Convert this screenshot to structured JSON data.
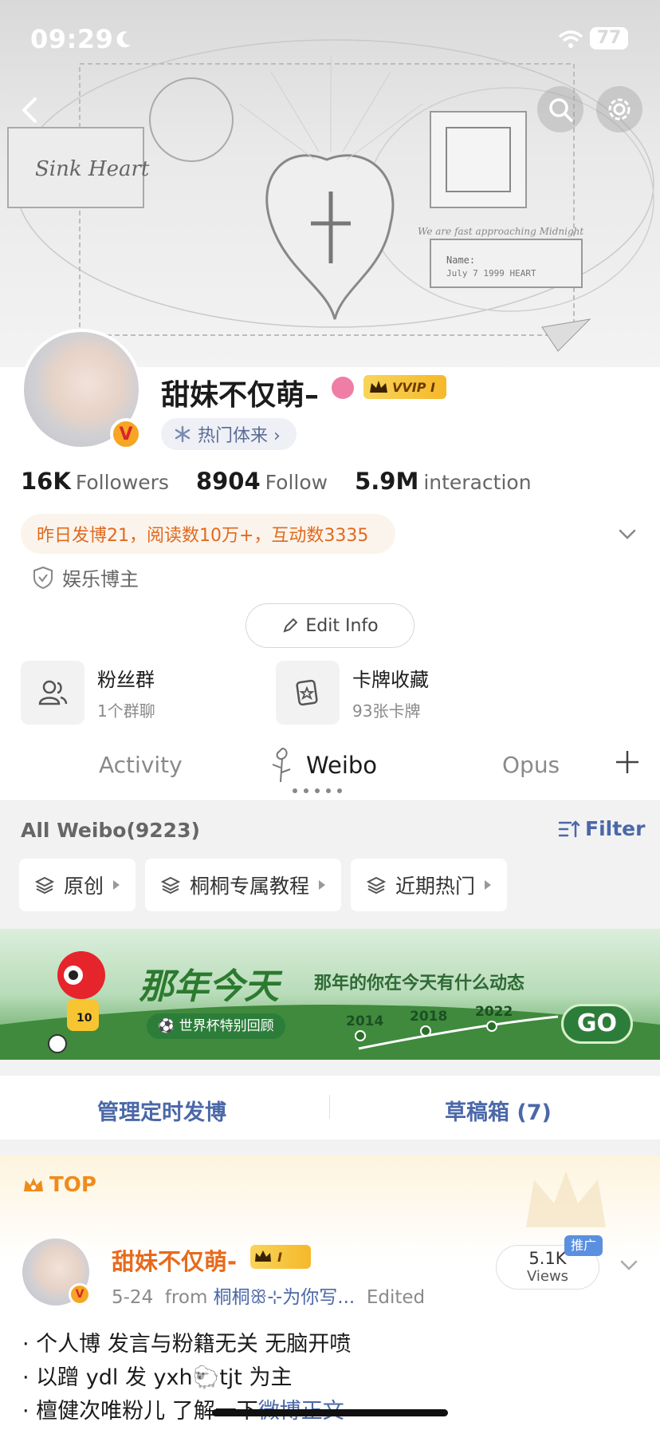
{
  "status_bar": {
    "time": "09:29",
    "battery": "77"
  },
  "profile": {
    "username": "甜妹不仅萌–",
    "vip_badge": "VVIP I",
    "hot_pill": "热门体来 ›",
    "stats": [
      {
        "value": "16K",
        "label": "Followers"
      },
      {
        "value": "8904",
        "label": "Follow"
      },
      {
        "value": "5.9M",
        "label": "interaction"
      }
    ],
    "summary": "昨日发博21，阅读数10万+，互动数3335",
    "certification": "娱乐博主",
    "edit_button": "Edit Info",
    "tiles": [
      {
        "title": "粉丝群",
        "subtitle": "1个群聊",
        "icon": "group-icon"
      },
      {
        "title": "卡牌收藏",
        "subtitle": "93张卡牌",
        "icon": "card-icon"
      }
    ]
  },
  "tabs": [
    {
      "label": "Activity",
      "active": false
    },
    {
      "label": "Weibo",
      "active": true
    },
    {
      "label": "Opus",
      "active": false
    }
  ],
  "feed": {
    "all_weibo": "All Weibo(9223)",
    "filter": "Filter",
    "categories": [
      "原创",
      "桐桐专属教程",
      "近期热门"
    ]
  },
  "banner": {
    "title": "那年今天",
    "subtitle": "那年的你在今天有什么动态",
    "chip": "⚽ 世界杯特别回顾",
    "years": [
      "2014",
      "2018",
      "2022"
    ],
    "go": "GO",
    "player_number": "10"
  },
  "schedule": {
    "manage": "管理定时发博",
    "drafts": "草稿箱 (7)"
  },
  "post": {
    "top_label": "TOP",
    "author": "甜妹不仅萌-",
    "author_vip": "I",
    "date": "5-24",
    "from_label": "from",
    "source": "桐桐ꕥ⊹为你写...",
    "edited": "Edited",
    "views_value": "5.1K",
    "views_label": "Views",
    "promo": "推广",
    "lines": [
      "· 个人博 发言与粉籍无关 无脑开喷",
      "· 以蹭 ydl 发 yxh🐑tjt 为主",
      "· 檀健次唯粉儿 了解一下"
    ],
    "link": "微博正文"
  },
  "colors": {
    "accent_orange": "#e86a1c",
    "link_blue": "#4b68a8",
    "vip_gold": "#f5b82a"
  }
}
